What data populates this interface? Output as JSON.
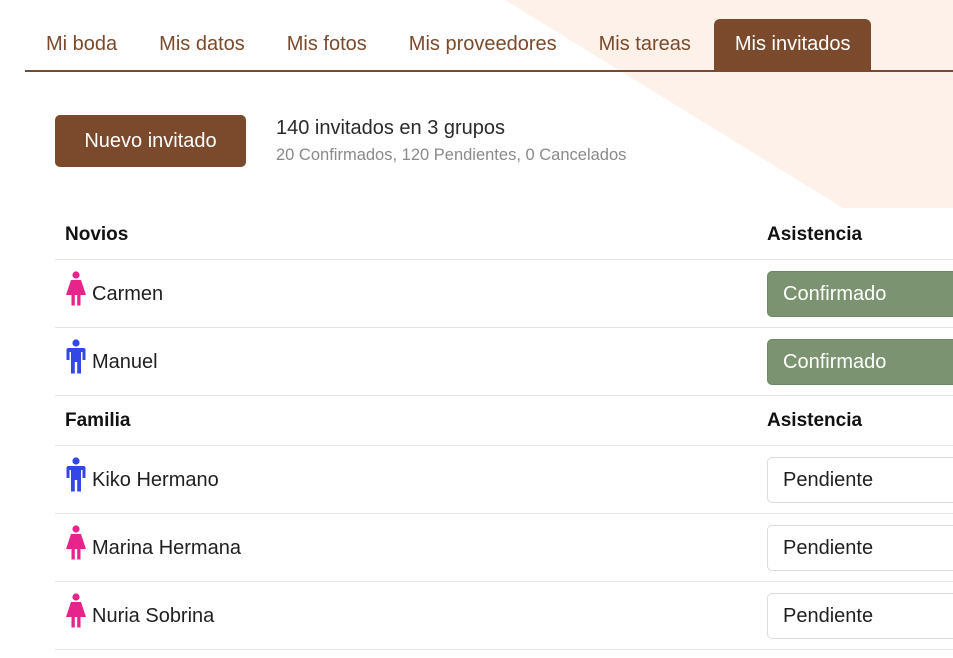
{
  "colors": {
    "brand": "#7b4a2c",
    "confirmed": "#7b9370",
    "female_icon": "#e7238c",
    "male_icon": "#3347e8"
  },
  "tabs": [
    {
      "label": "Mi boda",
      "active": false
    },
    {
      "label": "Mis datos",
      "active": false
    },
    {
      "label": "Mis fotos",
      "active": false
    },
    {
      "label": "Mis proveedores",
      "active": false
    },
    {
      "label": "Mis tareas",
      "active": false
    },
    {
      "label": "Mis invitados",
      "active": true
    }
  ],
  "summary": {
    "new_button": "Nuevo invitado",
    "title": "140 invitados en 3 grupos",
    "subtitle": "20 Confirmados, 120 Pendientes, 0 Cancelados"
  },
  "groups": [
    {
      "name": "Novios",
      "attendance_header": "Asistencia",
      "guests": [
        {
          "name": "Carmen",
          "icon": "female-icon",
          "status": "Confirmado"
        },
        {
          "name": "Manuel",
          "icon": "male-icon",
          "status": "Confirmado"
        }
      ]
    },
    {
      "name": "Familia",
      "attendance_header": "Asistencia",
      "guests": [
        {
          "name": "Kiko Hermano",
          "icon": "male-icon",
          "status": "Pendiente"
        },
        {
          "name": "Marina Hermana",
          "icon": "female-icon",
          "status": "Pendiente"
        },
        {
          "name": "Nuria Sobrina",
          "icon": "female-icon",
          "status": "Pendiente"
        }
      ]
    }
  ]
}
